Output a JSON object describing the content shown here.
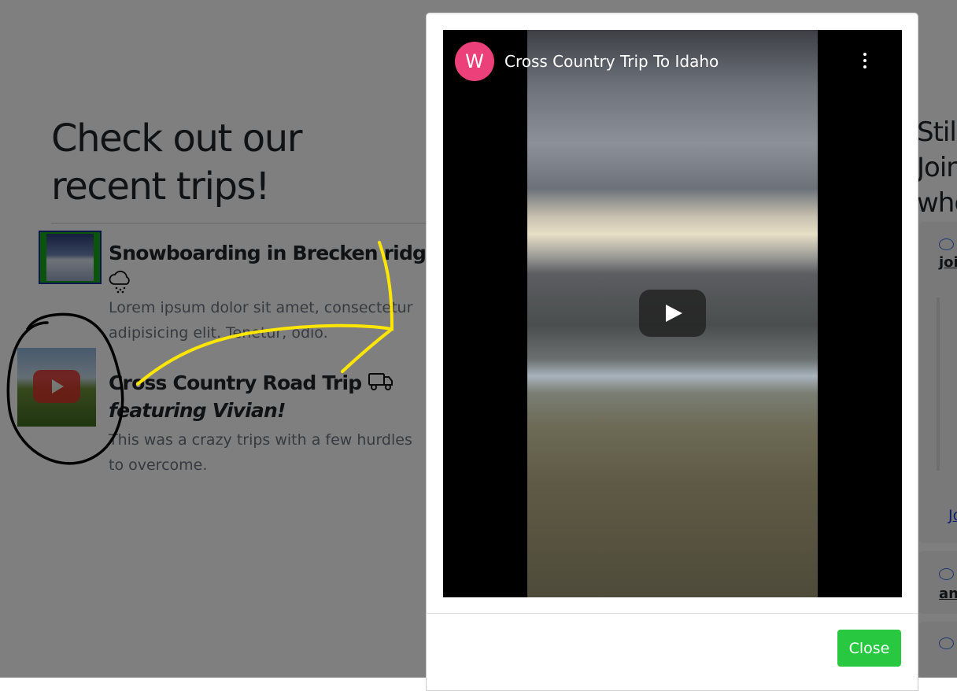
{
  "page": {
    "heading": "Check out our recent trips!",
    "trips": [
      {
        "title": "Snowboarding in Brecken ridge utah",
        "icon": "cloud-snow-icon",
        "description": "Lorem ipsum dolor sit amet, consectetur adipisicing elit. Tenetur, odio."
      },
      {
        "title": "Cross Country Road Trip",
        "icon": "truck-icon",
        "subtitle": "featuring Vivian!",
        "description": "This was a crazy trips with a few hurdles to overcome."
      }
    ],
    "sidebar": {
      "heading_lines": [
        "Still",
        "Join",
        "whe"
      ],
      "link1": "joi",
      "link2": "an",
      "join_link": "Jo"
    }
  },
  "annotations": {
    "circle_color": "#000000",
    "arrow_color": "#ffe600"
  },
  "modal": {
    "video": {
      "channel_initial": "W",
      "channel_color": "#ec407a",
      "title": "Cross Country Trip To Idaho",
      "menu_icon": "more-vertical-icon",
      "play_icon": "youtube-play-icon"
    },
    "close_label": "Close",
    "close_color": "#28c940"
  }
}
